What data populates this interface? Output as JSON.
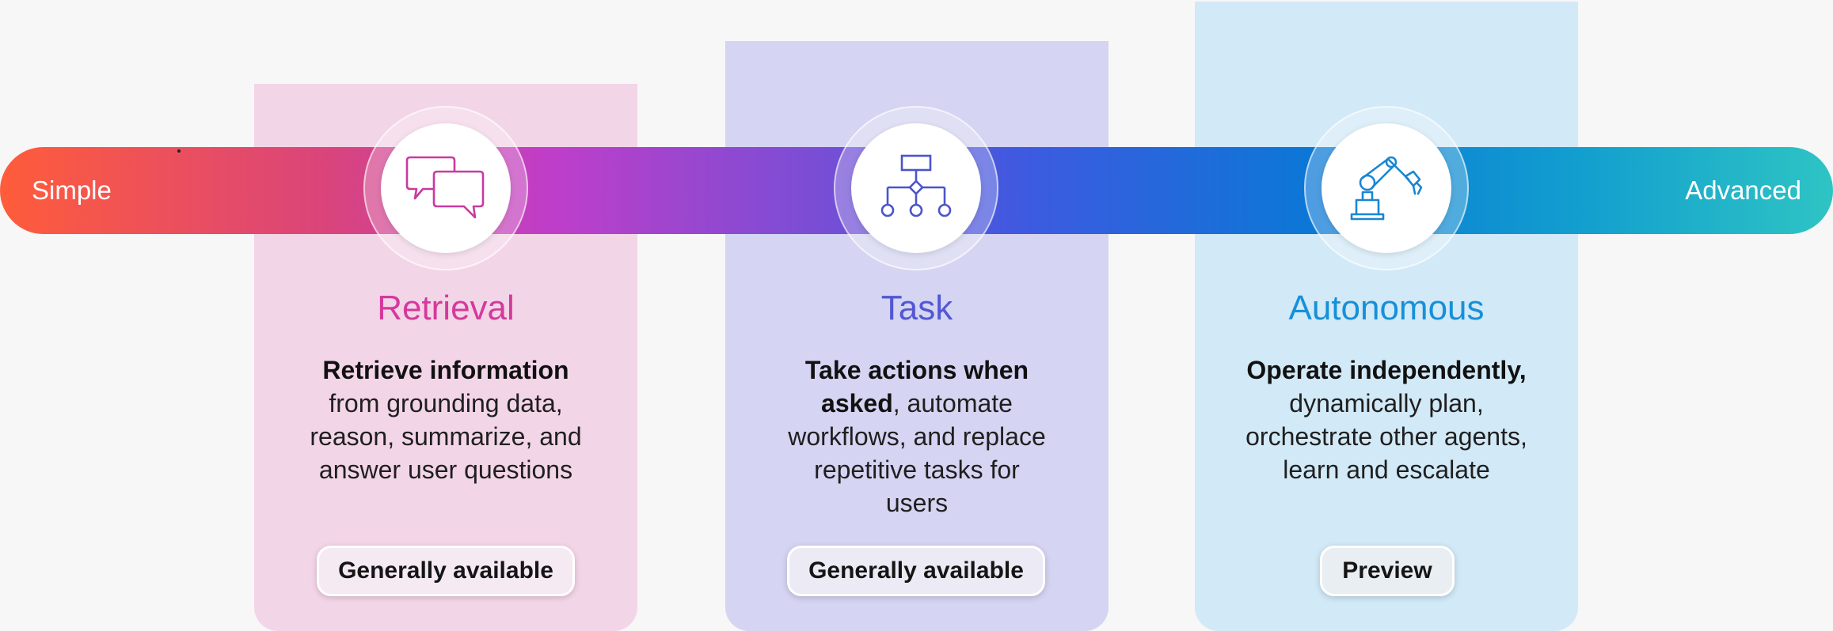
{
  "scale": {
    "start_label": "Simple",
    "end_label": "Advanced"
  },
  "colors": {
    "retrieval_accent": "#d43a9c",
    "task_accent": "#5257d2",
    "autonomous_accent": "#1690d8",
    "band_start": "#ff5c3a",
    "band_end": "#2ec4c4"
  },
  "cards": [
    {
      "icon": "chat-bubbles-icon",
      "title": "Retrieval",
      "description_bold": "Retrieve information",
      "description_rest": "from grounding data, reason, summarize, and answer user questions",
      "status": "Generally available"
    },
    {
      "icon": "workflow-diagram-icon",
      "title": "Task",
      "description_bold": "Take actions when asked",
      "description_rest": ", automate workflows, and replace repetitive tasks for users",
      "status": "Generally available"
    },
    {
      "icon": "robot-arm-icon",
      "title": "Autonomous",
      "description_bold": "Operate independently,",
      "description_rest": "dynamically plan, orchestrate other agents, learn and escalate",
      "status": "Preview"
    }
  ]
}
